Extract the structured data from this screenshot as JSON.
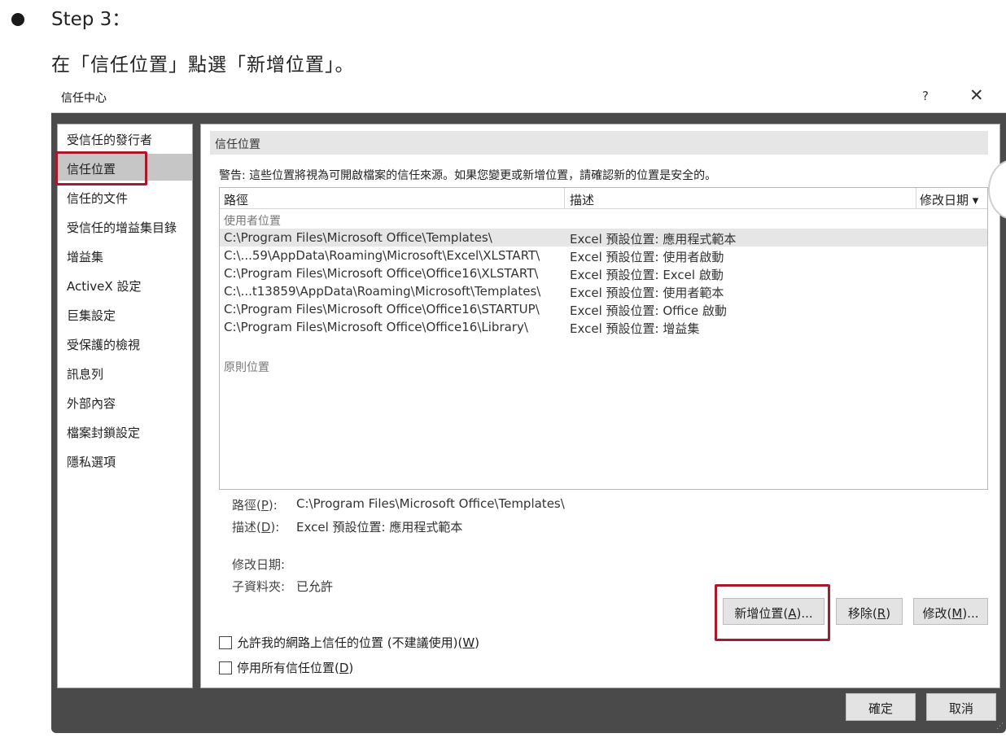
{
  "step": {
    "title": "Step 3：",
    "instruction": "在「信任位置」點選「新增位置」。"
  },
  "dialog": {
    "title": "信任中心",
    "help": "?",
    "close": "✕",
    "sidebar": {
      "items": [
        {
          "label": "受信任的發行者"
        },
        {
          "label": "信任位置"
        },
        {
          "label": "信任的文件"
        },
        {
          "label": "受信任的增益集目錄"
        },
        {
          "label": "增益集"
        },
        {
          "label": "ActiveX 設定"
        },
        {
          "label": "巨集設定"
        },
        {
          "label": "受保護的檢視"
        },
        {
          "label": "訊息列"
        },
        {
          "label": "外部內容"
        },
        {
          "label": "檔案封鎖設定"
        },
        {
          "label": "隱私選項"
        }
      ]
    },
    "main": {
      "section_title": "信任位置",
      "warning": "警告: 這些位置將視為可開啟檔案的信任來源。如果您變更或新增位置，請確認新的位置是安全的。",
      "columns": {
        "path": "路徑",
        "description": "描述",
        "modified": "修改日期 ▾"
      },
      "user_group_label": "使用者位置",
      "policy_group_label": "原則位置",
      "rows": [
        {
          "path": "C:\\Program Files\\Microsoft Office\\Templates\\",
          "description": "Excel 預設位置: 應用程式範本"
        },
        {
          "path": "C:\\...59\\AppData\\Roaming\\Microsoft\\Excel\\XLSTART\\",
          "description": "Excel 預設位置: 使用者啟動"
        },
        {
          "path": "C:\\Program Files\\Microsoft Office\\Office16\\XLSTART\\",
          "description": "Excel 預設位置: Excel 啟動"
        },
        {
          "path": "C:\\...t13859\\AppData\\Roaming\\Microsoft\\Templates\\",
          "description": "Excel 預設位置: 使用者範本"
        },
        {
          "path": "C:\\Program Files\\Microsoft Office\\Office16\\STARTUP\\",
          "description": "Excel 預設位置: Office 啟動"
        },
        {
          "path": "C:\\Program Files\\Microsoft Office\\Office16\\Library\\",
          "description": "Excel 預設位置: 增益集"
        }
      ],
      "details": {
        "path_label": "路徑(",
        "path_key": "P",
        "path_suffix": "):",
        "path_value": "C:\\Program Files\\Microsoft Office\\Templates\\",
        "desc_label": "描述(",
        "desc_key": "D",
        "desc_suffix": "):",
        "desc_value": "Excel 預設位置: 應用程式範本",
        "modified_label": "修改日期:",
        "subfolders_label": "子資料夾:",
        "subfolders_value": "已允許"
      },
      "buttons": {
        "add": {
          "prefix": "新增位置(",
          "key": "A",
          "suffix": ")..."
        },
        "remove": {
          "prefix": "移除(",
          "key": "R",
          "suffix": ")"
        },
        "modify": {
          "prefix": "修改(",
          "key": "M",
          "suffix": ")..."
        }
      },
      "checkboxes": {
        "allow_network": {
          "prefix": "允許我的網路上信任的位置 (不建議使用)(",
          "key": "W",
          "suffix": ")",
          "checked": false
        },
        "disable_all": {
          "prefix": "停用所有信任位置(",
          "key": "D",
          "suffix": ")",
          "checked": false
        }
      }
    },
    "footer": {
      "ok": "確定",
      "cancel": "取消"
    }
  },
  "colors": {
    "highlight_border": "#a8192b",
    "dialog_dark": "#4a4a4a",
    "selection": "#e6e6e6"
  }
}
